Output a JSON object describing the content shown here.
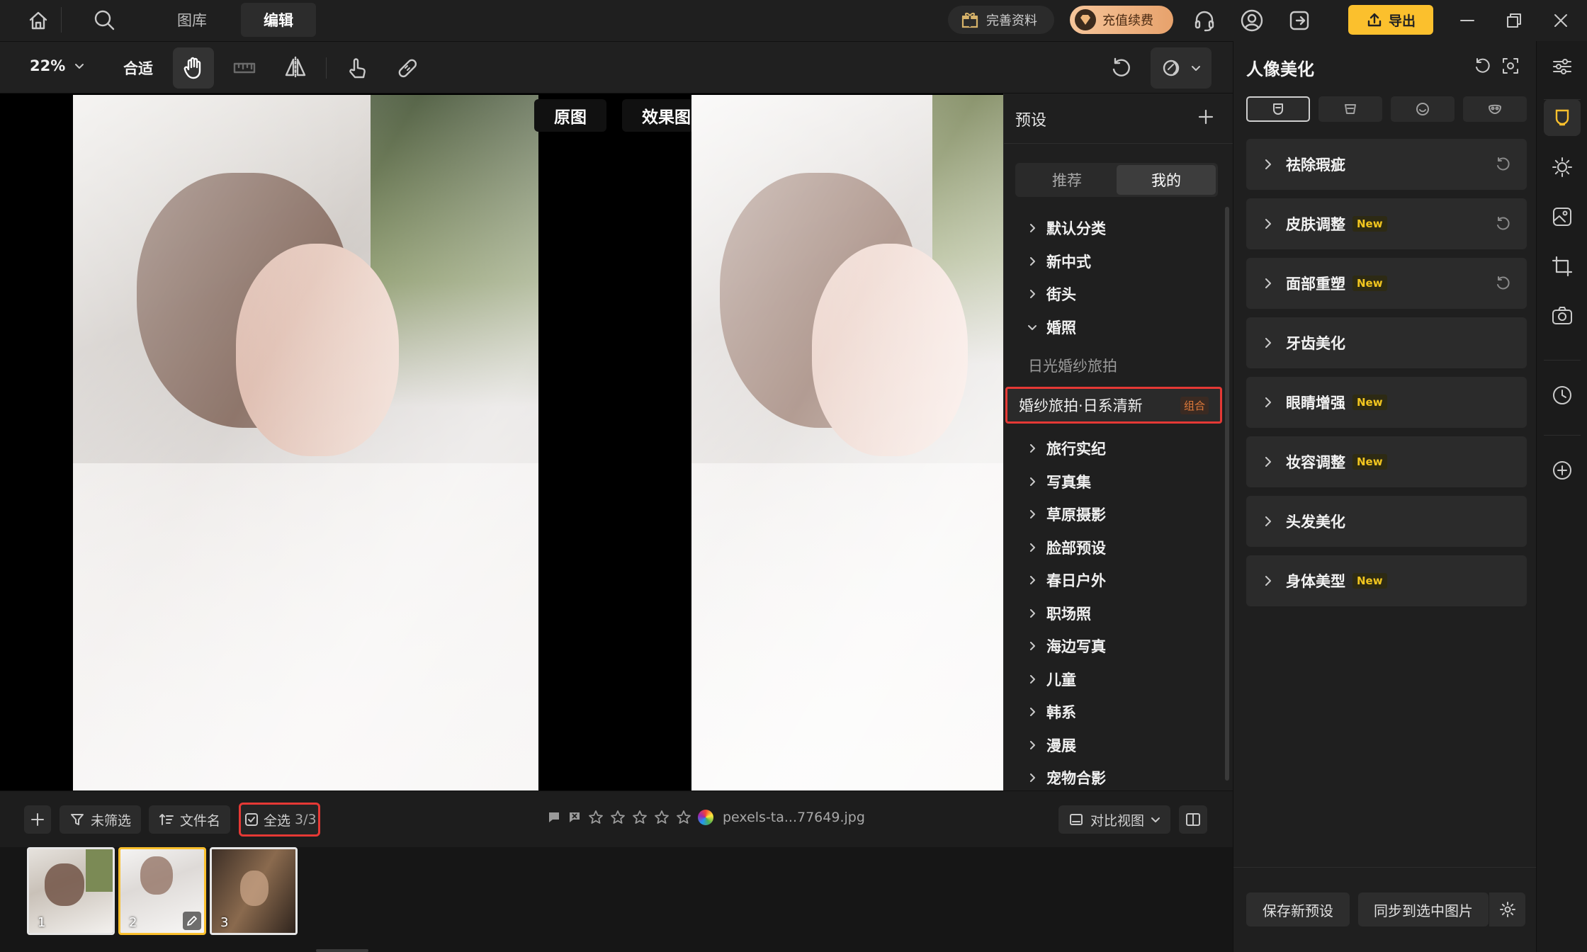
{
  "nav": {
    "gallery": "图库",
    "edit": "编辑"
  },
  "topbar": {
    "profile": "完善资料",
    "recharge": "充值续费",
    "export": "导出"
  },
  "toolbar": {
    "zoom": "22%",
    "fit": "合适"
  },
  "canvas": {
    "original_label": "原图",
    "effect_label": "效果图"
  },
  "preset": {
    "title": "预设",
    "tabs": [
      "推荐",
      "我的"
    ],
    "categories": [
      "默认分类",
      "新中式",
      "街头",
      "婚照",
      "旅行实纪",
      "写真集",
      "草原摄影",
      "脸部预设",
      "春日户外",
      "职场照",
      "海边写真",
      "儿童",
      "韩系",
      "漫展",
      "宠物合影"
    ],
    "sub_items": [
      "日光婚纱旅拍",
      "婚纱旅拍·日系清新"
    ],
    "combo_badge": "组合"
  },
  "portrait": {
    "title": "人像美化",
    "sections": [
      {
        "label": "祛除瑕疵",
        "badge": ""
      },
      {
        "label": "皮肤调整",
        "badge": "New"
      },
      {
        "label": "面部重塑",
        "badge": "New"
      },
      {
        "label": "牙齿美化",
        "badge": ""
      },
      {
        "label": "眼睛增强",
        "badge": "New"
      },
      {
        "label": "妆容调整",
        "badge": "New"
      },
      {
        "label": "头发美化",
        "badge": ""
      },
      {
        "label": "身体美型",
        "badge": "New"
      }
    ],
    "save_preset": "保存新预设",
    "sync": "同步到选中图片"
  },
  "bottom": {
    "filter": "未筛选",
    "sort": "文件名",
    "select_all": "全选",
    "select_count": "3/3",
    "filename": "pexels-ta...77649.jpg",
    "compare": "对比视图"
  },
  "thumbs": [
    "1",
    "2",
    "3"
  ],
  "colors": {
    "accent": "#fbc02d",
    "highlight_red": "#e53935"
  }
}
